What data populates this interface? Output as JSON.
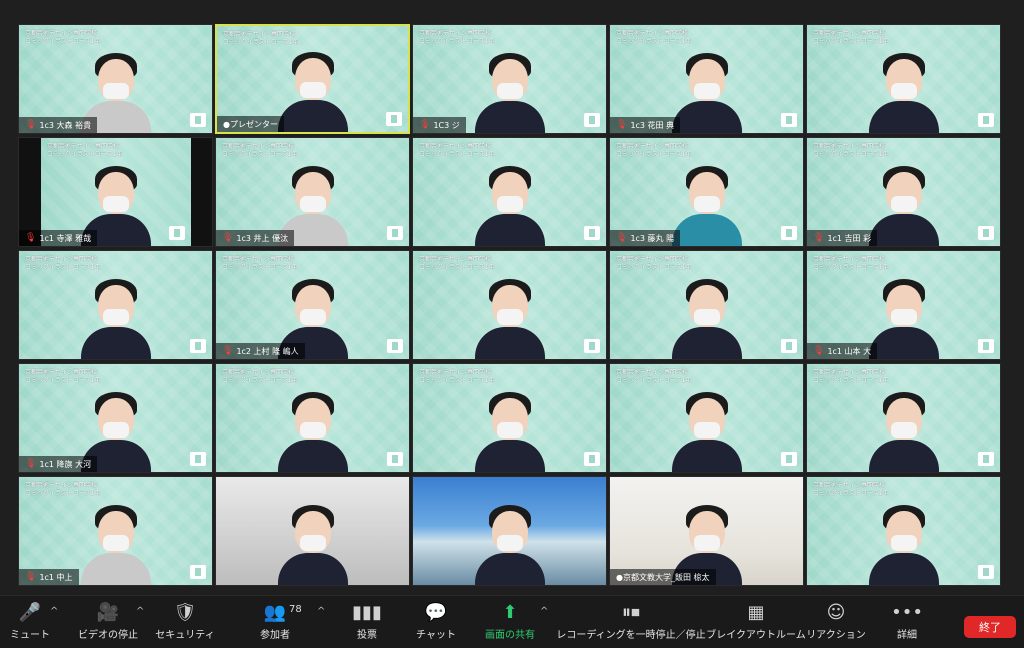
{
  "school_label": "京都芸術デザイン専門学校\nコミックイラストコース1年",
  "participants": [
    {
      "name": "1c3 大森 裕貴",
      "active": false,
      "style": "light"
    },
    {
      "name": "●プレゼンター",
      "active": true,
      "style": "suit"
    },
    {
      "name": "1C3 ジ",
      "active": false,
      "style": "suit"
    },
    {
      "name": "1c3 花田 典",
      "active": false,
      "style": "suit"
    },
    {
      "name": "",
      "active": false,
      "style": "suit"
    },
    {
      "name": "1c1 寺澤 雅哉",
      "active": false,
      "style": "suit"
    },
    {
      "name": "1c3 井上 優汰",
      "active": false,
      "style": "light"
    },
    {
      "name": "",
      "active": false,
      "style": "suit"
    },
    {
      "name": "1c3 藤丸 陽",
      "active": false,
      "style": "teal"
    },
    {
      "name": "1c1 吉田 彩",
      "active": false,
      "style": "suit"
    },
    {
      "name": "",
      "active": false,
      "style": "suit"
    },
    {
      "name": "1c2 上村 隆 嶋人",
      "active": false,
      "style": "suit"
    },
    {
      "name": "",
      "active": false,
      "style": "suit"
    },
    {
      "name": "",
      "active": false,
      "style": "suit"
    },
    {
      "name": "1c1 山本 大",
      "active": false,
      "style": "suit"
    },
    {
      "name": "1c1 降旗 大河",
      "active": false,
      "style": "suit"
    },
    {
      "name": "",
      "active": false,
      "style": "suit"
    },
    {
      "name": "",
      "active": false,
      "style": "suit"
    },
    {
      "name": "",
      "active": false,
      "style": "suit"
    },
    {
      "name": "",
      "active": false,
      "style": "suit"
    },
    {
      "name": "1c1 中上 ",
      "active": false,
      "style": "light"
    },
    {
      "name": "",
      "active": false,
      "style": "photo1"
    },
    {
      "name": "",
      "active": false,
      "style": "photo2"
    },
    {
      "name": "●京都文教大学_飯田 椋太",
      "active": false,
      "style": "photo3"
    },
    {
      "name": "",
      "active": false,
      "style": "suit"
    }
  ],
  "toolbar": {
    "mute_label": "ミュート",
    "video_label": "ビデオの停止",
    "security_label": "セキュリティ",
    "participants_label": "参加者",
    "participants_count": "78",
    "polls_label": "投票",
    "chat_label": "チャット",
    "share_label": "画面の共有",
    "recording_label": "レコーディングを一時停止／停止",
    "breakout_label": "ブレイクアウトルーム",
    "reactions_label": "リアクション",
    "more_label": "詳細",
    "end_label": "終了"
  },
  "colors": {
    "active_border": "#d6e34a",
    "end_button": "#e02828",
    "share_green": "#2ecc71",
    "tile_teal": "#a7ddd0"
  },
  "icons": {
    "mute": "microphone-icon",
    "video": "video-camera-icon",
    "security": "shield-icon",
    "participants": "people-icon",
    "polls": "bar-chart-icon",
    "chat": "chat-bubble-icon",
    "share": "share-screen-icon",
    "recording": "pause-stop-icon",
    "breakout": "grid-icon",
    "reactions": "smile-plus-icon",
    "more": "more-dots-icon"
  }
}
